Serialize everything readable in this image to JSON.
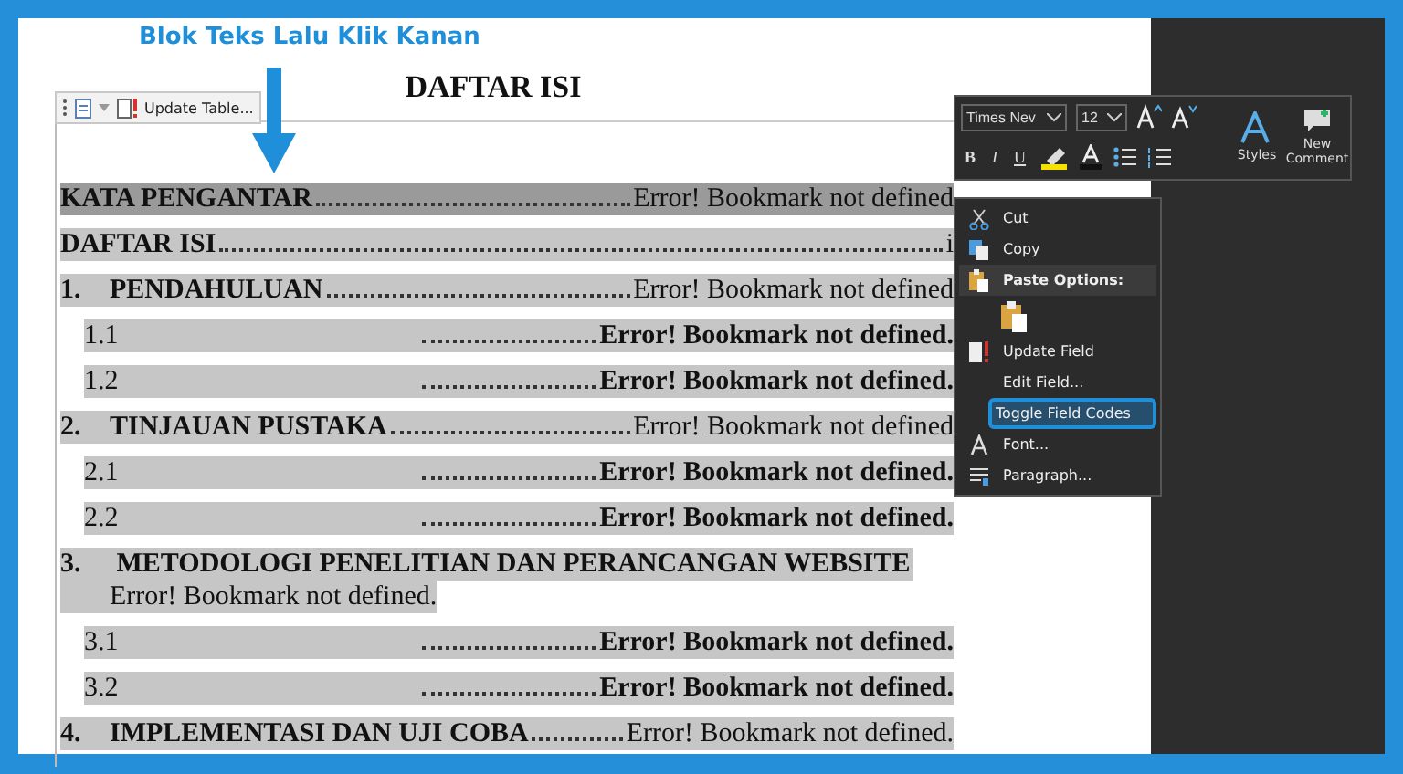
{
  "annotation": {
    "text": "Blok Teks Lalu Klik Kanan"
  },
  "field_tab": {
    "label": "Update Table..."
  },
  "document": {
    "title": "DAFTAR ISI",
    "entries": [
      {
        "kind": "front",
        "title": "KATA PENGANTAR",
        "page": "Error! Bookmark not defined",
        "selected": true
      },
      {
        "kind": "front",
        "title": "DAFTAR ISI",
        "page": "i",
        "selected": false
      },
      {
        "kind": "chapter",
        "number": "1.",
        "title": "PENDAHULUAN",
        "page": "Error! Bookmark not defined",
        "selected": false
      },
      {
        "kind": "section",
        "number": "1.1",
        "page": "Error! Bookmark not defined.",
        "selected": false
      },
      {
        "kind": "section",
        "number": "1.2",
        "page": "Error! Bookmark not defined.",
        "selected": false
      },
      {
        "kind": "chapter",
        "number": "2.",
        "title": "TINJAUAN PUSTAKA",
        "page": "Error! Bookmark not defined",
        "selected": false
      },
      {
        "kind": "section",
        "number": "2.1",
        "page": "Error! Bookmark not defined.",
        "selected": false
      },
      {
        "kind": "section",
        "number": "2.2",
        "page": "Error! Bookmark not defined.",
        "selected": false
      },
      {
        "kind": "chapter-wrapped",
        "number": "3.",
        "title": "METODOLOGI PENELITIAN DAN PERANCANGAN WEBSITE",
        "page": "Error! Bookmark not defined.",
        "selected": false
      },
      {
        "kind": "section",
        "number": "3.1",
        "page": "Error! Bookmark not defined.",
        "selected": false
      },
      {
        "kind": "section",
        "number": "3.2",
        "page": "Error! Bookmark not defined.",
        "selected": false
      },
      {
        "kind": "chapter",
        "number": "4.",
        "title": "IMPLEMENTASI DAN UJI COBA",
        "page": "Error! Bookmark not defined.",
        "selected": false
      }
    ]
  },
  "mini_toolbar": {
    "font": "Times Nev",
    "size": "12",
    "format_buttons": [
      "B",
      "I",
      "U"
    ],
    "styles_label": "Styles",
    "comment_label": "New Comment"
  },
  "context_menu": {
    "items": [
      {
        "kind": "cut",
        "label": "Cut",
        "selected": false
      },
      {
        "kind": "copy",
        "label": "Copy",
        "selected": false
      },
      {
        "kind": "header",
        "label": "Paste Options:",
        "selected": false
      },
      {
        "kind": "paste",
        "selected": false
      },
      {
        "kind": "update",
        "label": "Update Field",
        "selected": false
      },
      {
        "kind": "item",
        "label": "Edit Field...",
        "selected": false
      },
      {
        "kind": "item",
        "label": "Toggle Field Codes",
        "selected": true
      },
      {
        "kind": "font",
        "label": "Font...",
        "selected": false
      },
      {
        "kind": "paragraph",
        "label": "Paragraph...",
        "selected": false
      }
    ]
  }
}
